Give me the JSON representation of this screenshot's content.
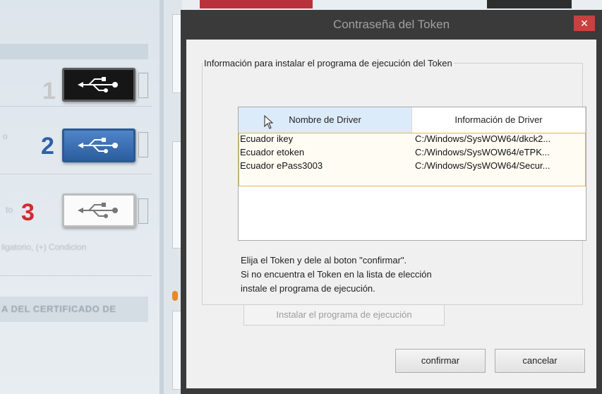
{
  "background": {
    "steps": [
      {
        "number": "1",
        "color": "#c7c7c7",
        "usb_style": "black"
      },
      {
        "number": "2",
        "color": "#2e61a6",
        "usb_style": "blue"
      },
      {
        "number": "3",
        "color": "#d12c2c",
        "usb_style": "white"
      }
    ],
    "blurred_text": {
      "fragment_to": "to",
      "fragment_o": "o",
      "fragment_obligatorio": "ligatorio, (+) Condicion",
      "fragment_certificado": "A DEL CERTIFICADO DE"
    }
  },
  "dialog": {
    "title": "Contraseña del Token",
    "close_icon": "close-icon",
    "group_label": "Información para instalar el programa de ejecución del Token",
    "table": {
      "columns": [
        "Nombre de Driver",
        "Información de Driver"
      ],
      "rows": [
        {
          "name": "Ecuador ikey",
          "info": "C:/Windows/SysWOW64/dkck2..."
        },
        {
          "name": "Ecuador etoken",
          "info": "C:/Windows/SysWOW64/eTPK..."
        },
        {
          "name": "Ecuador ePass3003",
          "info": "C:/Windows/SysWOW64/Secur..."
        }
      ]
    },
    "instructions": [
      "Elija el Token y dele al boton \"confirmar\".",
      "Si no encuentra el Token en la lista de elección",
      "instale el programa de ejecución."
    ],
    "install_button": "Instalar el programa de ejecución",
    "confirm_button": "confirmar",
    "cancel_button": "cancelar"
  }
}
